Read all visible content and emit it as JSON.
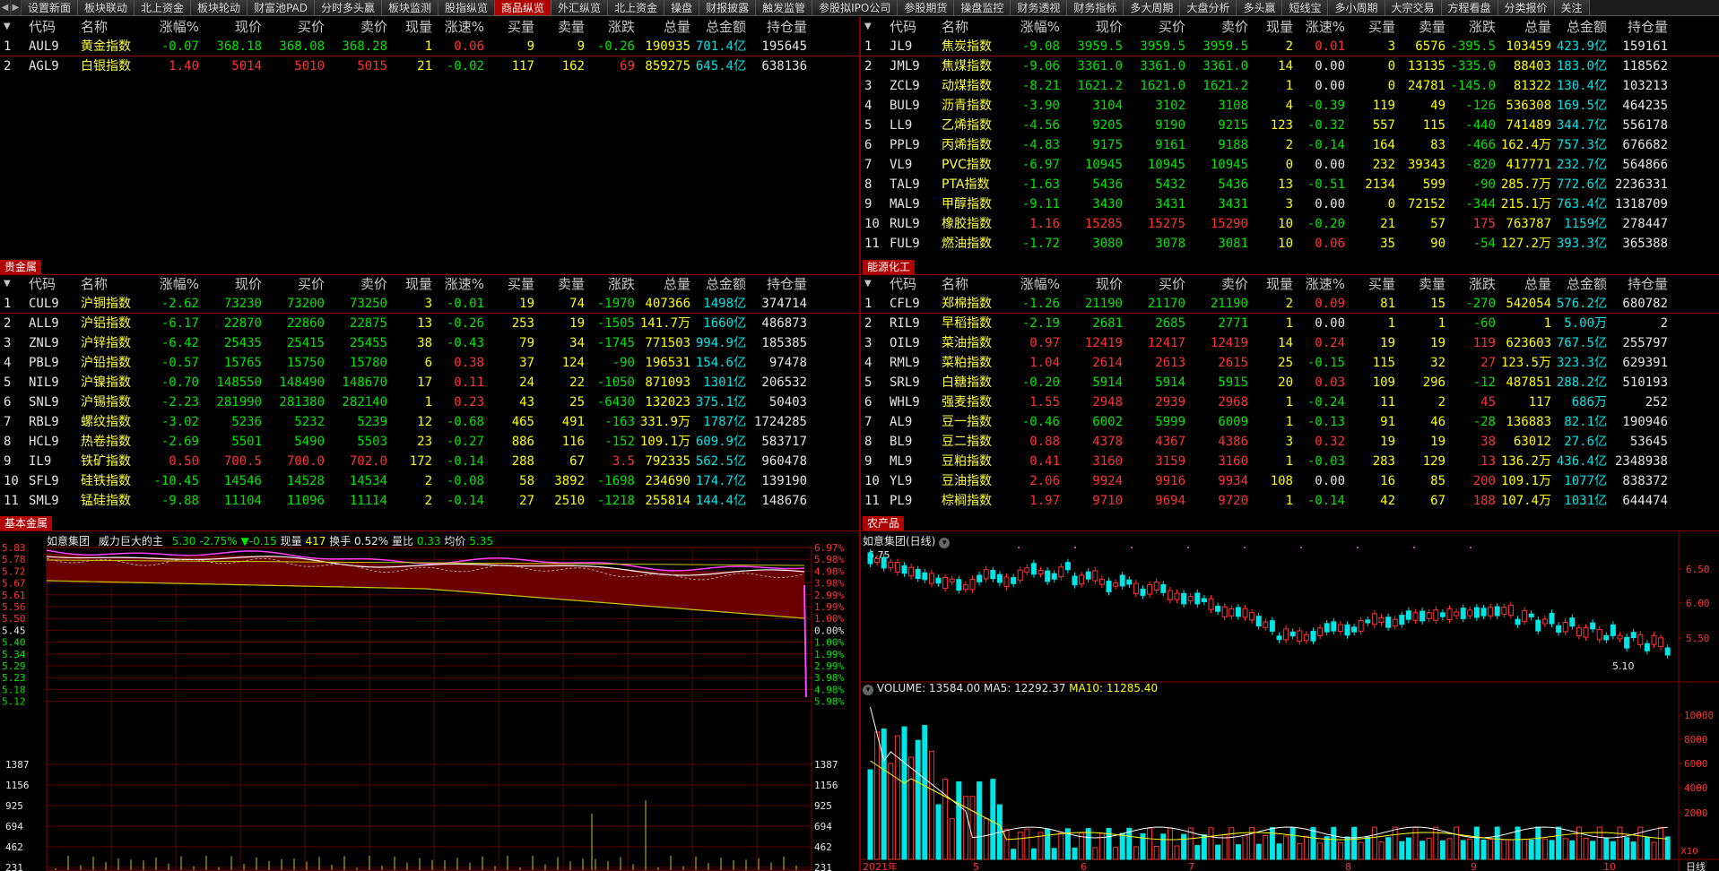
{
  "tabs": [
    "设置新面",
    "板块联动",
    "北上资金",
    "板块轮动",
    "财富池PAD",
    "分时多头赢",
    "板块监测",
    "股指纵览",
    "商品纵览",
    "外汇纵览",
    "北上资金",
    "操盘",
    "财报披露",
    "触发监管",
    "参股拟IPO公司",
    "参股期货",
    "操盘监控",
    "财务透视",
    "财务指标",
    "多大周期",
    "大盘分析",
    "多头赢",
    "短线宝",
    "多小周期",
    "大宗交易",
    "方程看盘",
    "分类报价",
    "关注"
  ],
  "active_tab": 8,
  "headers": {
    "left": [
      "代码",
      "名称",
      "涨幅%",
      "现价",
      "买价",
      "卖价",
      "现量",
      "涨速%",
      "买量",
      "卖量",
      "涨跌",
      "总量",
      "总金额",
      "持仓量"
    ],
    "right": [
      "代码",
      "名称",
      "涨幅%",
      "现价",
      "买价",
      "卖价",
      "现量",
      "涨速%",
      "买量",
      "卖量",
      "涨跌",
      "总量",
      "总金额",
      "持仓量"
    ]
  },
  "sections": {
    "precious": "贵金属",
    "energy": "能源化工",
    "base": "基本金属",
    "agri": "农产品"
  },
  "panel_top_left": [
    [
      "1",
      "AUL9",
      "黄金指数",
      "-0.07",
      "368.18",
      "368.08",
      "368.28",
      "1",
      "0.06",
      "9",
      "9",
      "-0.26",
      "190935",
      "701.4亿",
      "195645"
    ],
    [
      "2",
      "AGL9",
      "白银指数",
      "1.40",
      "5014",
      "5010",
      "5015",
      "21",
      "-0.02",
      "117",
      "162",
      "69",
      "859275",
      "645.4亿",
      "638136"
    ]
  ],
  "panel_top_right": [
    [
      "1",
      "JL9",
      "焦炭指数",
      "-9.08",
      "3959.5",
      "3959.5",
      "3959.5",
      "2",
      "0.01",
      "3",
      "6576",
      "-395.5",
      "103459",
      "423.9亿",
      "159161"
    ],
    [
      "2",
      "JML9",
      "焦煤指数",
      "-9.06",
      "3361.0",
      "3361.0",
      "3361.0",
      "14",
      "0.00",
      "0",
      "13135",
      "-335.0",
      "88403",
      "183.0亿",
      "118562"
    ],
    [
      "3",
      "ZCL9",
      "动煤指数",
      "-8.21",
      "1621.2",
      "1621.0",
      "1621.2",
      "1",
      "0.00",
      "0",
      "24781",
      "-145.0",
      "81322",
      "130.4亿",
      "103213"
    ],
    [
      "4",
      "BUL9",
      "沥青指数",
      "-3.90",
      "3104",
      "3102",
      "3108",
      "4",
      "-0.39",
      "119",
      "49",
      "-126",
      "536308",
      "169.5亿",
      "464235"
    ],
    [
      "5",
      "LL9",
      "乙烯指数",
      "-4.56",
      "9205",
      "9190",
      "9215",
      "123",
      "-0.32",
      "557",
      "115",
      "-440",
      "741489",
      "344.7亿",
      "556178"
    ],
    [
      "6",
      "PPL9",
      "丙烯指数",
      "-4.83",
      "9175",
      "9161",
      "9188",
      "2",
      "-0.14",
      "164",
      "83",
      "-466",
      "162.4万",
      "757.3亿",
      "676682"
    ],
    [
      "7",
      "VL9",
      "PVC指数",
      "-6.97",
      "10945",
      "10945",
      "10945",
      "0",
      "0.00",
      "232",
      "39343",
      "-820",
      "417771",
      "232.7亿",
      "564866"
    ],
    [
      "8",
      "TAL9",
      "PTA指数",
      "-1.63",
      "5436",
      "5432",
      "5436",
      "13",
      "-0.51",
      "2134",
      "599",
      "-90",
      "285.7万",
      "772.6亿",
      "2236331"
    ],
    [
      "9",
      "MAL9",
      "甲醇指数",
      "-9.11",
      "3430",
      "3431",
      "3431",
      "3",
      "0.00",
      "0",
      "72152",
      "-344",
      "215.1万",
      "763.4亿",
      "1318709"
    ],
    [
      "10",
      "RUL9",
      "橡胶指数",
      "1.16",
      "15285",
      "15275",
      "15290",
      "10",
      "-0.20",
      "21",
      "57",
      "175",
      "763787",
      "1159亿",
      "278447"
    ],
    [
      "11",
      "FUL9",
      "燃油指数",
      "-1.72",
      "3080",
      "3078",
      "3081",
      "10",
      "0.06",
      "35",
      "90",
      "-54",
      "127.2万",
      "393.3亿",
      "365388"
    ]
  ],
  "panel_mid_left": [
    [
      "1",
      "CUL9",
      "沪铜指数",
      "-2.62",
      "73230",
      "73200",
      "73250",
      "3",
      "-0.01",
      "19",
      "74",
      "-1970",
      "407366",
      "1498亿",
      "374714"
    ],
    [
      "2",
      "ALL9",
      "沪铝指数",
      "-6.17",
      "22870",
      "22860",
      "22875",
      "13",
      "-0.26",
      "253",
      "19",
      "-1505",
      "141.7万",
      "1660亿",
      "486873"
    ],
    [
      "3",
      "ZNL9",
      "沪锌指数",
      "-6.42",
      "25435",
      "25415",
      "25455",
      "38",
      "-0.43",
      "79",
      "34",
      "-1745",
      "771503",
      "994.9亿",
      "185385"
    ],
    [
      "4",
      "PBL9",
      "沪铅指数",
      "-0.57",
      "15765",
      "15750",
      "15780",
      "6",
      "0.38",
      "37",
      "124",
      "-90",
      "196531",
      "154.6亿",
      "97478"
    ],
    [
      "5",
      "NIL9",
      "沪镍指数",
      "-0.70",
      "148550",
      "148490",
      "148670",
      "17",
      "0.11",
      "24",
      "22",
      "-1050",
      "871093",
      "1301亿",
      "206532"
    ],
    [
      "6",
      "SNL9",
      "沪锡指数",
      "-2.23",
      "281990",
      "281380",
      "282140",
      "1",
      "0.23",
      "43",
      "25",
      "-6430",
      "132023",
      "375.1亿",
      "50403"
    ],
    [
      "7",
      "RBL9",
      "螺纹指数",
      "-3.02",
      "5236",
      "5232",
      "5239",
      "12",
      "-0.68",
      "465",
      "491",
      "-163",
      "331.9万",
      "1787亿",
      "1724285"
    ],
    [
      "8",
      "HCL9",
      "热卷指数",
      "-2.69",
      "5501",
      "5490",
      "5503",
      "23",
      "-0.27",
      "886",
      "116",
      "-152",
      "109.1万",
      "609.9亿",
      "583717"
    ],
    [
      "9",
      "IL9",
      "铁矿指数",
      "0.50",
      "700.5",
      "700.0",
      "702.0",
      "172",
      "-0.14",
      "288",
      "67",
      "3.5",
      "792335",
      "562.5亿",
      "960478"
    ],
    [
      "10",
      "SFL9",
      "硅铁指数",
      "-10.45",
      "14546",
      "14528",
      "14534",
      "2",
      "-0.08",
      "58",
      "3892",
      "-1698",
      "234690",
      "174.7亿",
      "139190"
    ],
    [
      "11",
      "SML9",
      "锰硅指数",
      "-9.88",
      "11104",
      "11096",
      "11114",
      "2",
      "-0.14",
      "27",
      "2510",
      "-1218",
      "255814",
      "144.4亿",
      "148676"
    ]
  ],
  "panel_mid_right": [
    [
      "1",
      "CFL9",
      "郑棉指数",
      "-1.26",
      "21190",
      "21170",
      "21190",
      "2",
      "0.09",
      "81",
      "15",
      "-270",
      "542054",
      "576.2亿",
      "680782"
    ],
    [
      "2",
      "RIL9",
      "早稻指数",
      "-2.19",
      "2681",
      "2685",
      "2771",
      "1",
      "0.00",
      "1",
      "1",
      "-60",
      "1",
      "5.00万",
      "2"
    ],
    [
      "3",
      "OIL9",
      "菜油指数",
      "0.97",
      "12419",
      "12417",
      "12419",
      "14",
      "0.24",
      "19",
      "19",
      "119",
      "623603",
      "767.5亿",
      "255797"
    ],
    [
      "4",
      "RML9",
      "菜粕指数",
      "1.04",
      "2614",
      "2613",
      "2615",
      "25",
      "-0.15",
      "115",
      "32",
      "27",
      "123.5万",
      "323.3亿",
      "629391"
    ],
    [
      "5",
      "SRL9",
      "白糖指数",
      "-0.20",
      "5914",
      "5914",
      "5915",
      "20",
      "0.03",
      "109",
      "296",
      "-12",
      "487851",
      "288.2亿",
      "510193"
    ],
    [
      "6",
      "WHL9",
      "强麦指数",
      "1.55",
      "2948",
      "2939",
      "2968",
      "1",
      "-0.24",
      "11",
      "2",
      "45",
      "117",
      "686万",
      "252"
    ],
    [
      "7",
      "AL9",
      "豆一指数",
      "-0.46",
      "6002",
      "5999",
      "6009",
      "1",
      "-0.13",
      "91",
      "46",
      "-28",
      "136883",
      "82.1亿",
      "190946"
    ],
    [
      "8",
      "BL9",
      "豆二指数",
      "0.88",
      "4378",
      "4367",
      "4386",
      "3",
      "0.32",
      "19",
      "19",
      "38",
      "63012",
      "27.6亿",
      "53645"
    ],
    [
      "9",
      "ML9",
      "豆粕指数",
      "0.41",
      "3160",
      "3159",
      "3160",
      "1",
      "-0.03",
      "283",
      "129",
      "13",
      "136.2万",
      "436.4亿",
      "2348938"
    ],
    [
      "10",
      "YL9",
      "豆油指数",
      "2.06",
      "9924",
      "9916",
      "9934",
      "108",
      "0.00",
      "16",
      "85",
      "200",
      "109.1万",
      "1077亿",
      "838372"
    ],
    [
      "11",
      "PL9",
      "棕榈指数",
      "1.97",
      "9710",
      "9694",
      "9720",
      "1",
      "-0.14",
      "42",
      "67",
      "188",
      "107.4万",
      "1031亿",
      "644474"
    ]
  ],
  "intraday": {
    "title": "如意集团",
    "subtitle": "威力巨大的主",
    "price": "5.30",
    "pct": "-2.75%",
    "chg": "▼-0.15",
    "vol_label": "现量",
    "vol": "417",
    "turn_label": "换手",
    "turn": "0.52%",
    "ratio_label": "量比",
    "ratio": "0.33",
    "avg_label": "均价",
    "avg": "5.35",
    "left_ticks": [
      "5.83",
      "5.78",
      "5.72",
      "5.67",
      "5.61",
      "5.56",
      "5.50",
      "5.45",
      "5.40",
      "5.34",
      "5.29",
      "5.23",
      "5.18",
      "5.12"
    ],
    "right_ticks": [
      "6.97%",
      "5.98%",
      "4.98%",
      "3.98%",
      "2.99%",
      "1.99%",
      "1.00%",
      "0.00%",
      "1.00%",
      "1.99%",
      "2.99%",
      "3.98%",
      "4.98%",
      "5.98%"
    ],
    "vol_ticks": [
      "1387",
      "1156",
      "925",
      "694",
      "462",
      "231"
    ]
  },
  "kline": {
    "title": "如意集团(日线)",
    "hi_label": "6.75",
    "lo_label": "5.10",
    "price_ticks": [
      "6.50",
      "6.00",
      "5.50"
    ],
    "vol_header": "VOLUME: 13584.00",
    "ma5": "MA5: 12292.37",
    "ma10": "MA10: 11285.40",
    "vol_ticks": [
      "10000",
      "8000",
      "6000",
      "4000",
      "2000"
    ],
    "x_labels": [
      "2021年",
      "5",
      "6",
      "7",
      "8",
      "9",
      "10"
    ],
    "unit": "X10",
    "period": "日线"
  },
  "colors": {
    "up": "#ff3232",
    "down": "#00e600",
    "accent": "#b00000",
    "name": "#ffff40",
    "amount": "#00e6e6"
  }
}
